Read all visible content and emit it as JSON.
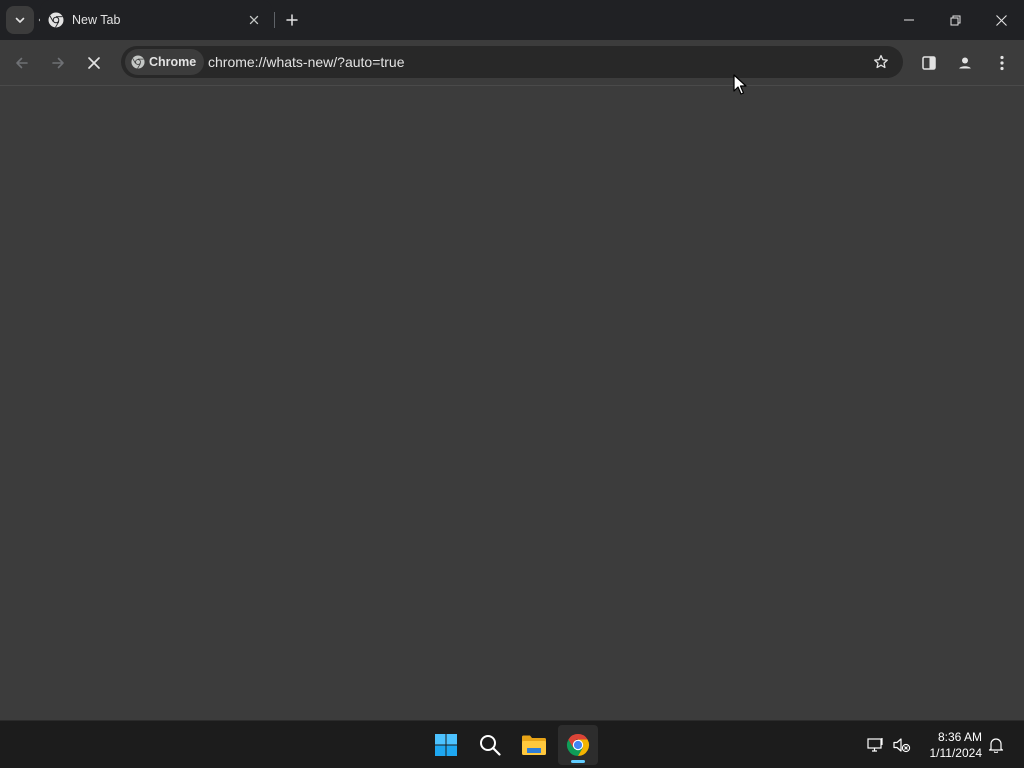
{
  "tabstrip": {
    "tab": {
      "title": "New Tab"
    }
  },
  "toolbar": {
    "chip_label": "Chrome",
    "url": "chrome://whats-new/?auto=true"
  },
  "taskbar": {
    "time": "8:36 AM",
    "date": "1/11/2024"
  },
  "colors": {
    "frame": "#202124",
    "toolbar": "#3c3c3c",
    "omnibox": "#282828",
    "content": "#3c3c3c",
    "taskbar": "#1c1c1c",
    "accent": "#60cdff"
  },
  "icons": {
    "tab_search": "chevron-down-icon",
    "favicon": "chrome-icon",
    "tab_close": "close-icon",
    "new_tab": "plus-icon",
    "back": "arrow-left-icon",
    "forward": "arrow-right-icon",
    "stop": "close-icon",
    "bookmark": "star-icon",
    "side_panel": "side-panel-icon",
    "profile": "person-icon",
    "menu": "kebab-menu-icon"
  }
}
